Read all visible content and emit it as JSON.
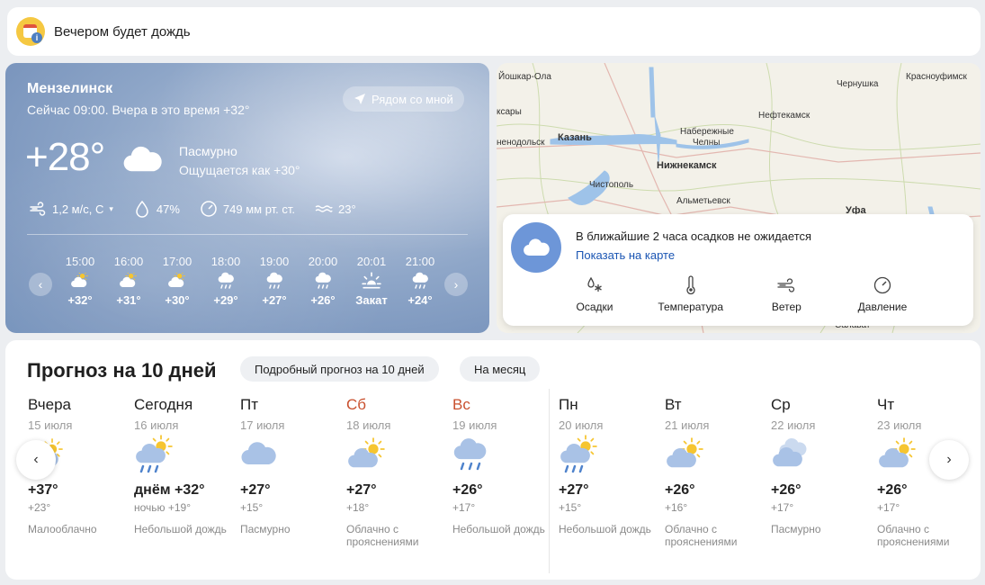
{
  "alert": {
    "text": "Вечером будет дождь",
    "icon": "calendar-info-icon"
  },
  "current": {
    "city": "Мензелинск",
    "subtitle": "Сейчас 09:00. Вчера в это время +32°",
    "nearby_label": "Рядом со мной",
    "temperature": "+28°",
    "condition": "Пасмурно",
    "feels_like": "Ощущается как +30°",
    "stats": {
      "wind": "1,2 м/с, С",
      "humidity": "47%",
      "pressure": "749 мм рт. ст.",
      "water": "23°"
    },
    "hourly": [
      {
        "time": "15:00",
        "icon": "cloud-sun-icon",
        "temp": "+32°"
      },
      {
        "time": "16:00",
        "icon": "cloud-sun-icon",
        "temp": "+31°"
      },
      {
        "time": "17:00",
        "icon": "cloud-sun-icon",
        "temp": "+30°"
      },
      {
        "time": "18:00",
        "icon": "cloud-rain-icon",
        "temp": "+29°"
      },
      {
        "time": "19:00",
        "icon": "cloud-rain-icon",
        "temp": "+27°"
      },
      {
        "time": "20:00",
        "icon": "cloud-rain-icon",
        "temp": "+26°"
      },
      {
        "time": "20:01",
        "icon": "sunset-icon",
        "temp": "Закат"
      },
      {
        "time": "21:00",
        "icon": "cloud-rain-icon",
        "temp": "+24°"
      }
    ]
  },
  "map": {
    "labels": [
      "Йошкар-Ола",
      "Чернушка",
      "Красноуфимск",
      "ксары",
      "Нефтекамск",
      "Набережные",
      "Челны",
      "Казань",
      "ненодольск",
      "Нижнекамск",
      "Чистополь",
      "Альметьевск",
      "Уфа",
      "Салават"
    ],
    "precip_title": "В ближайшие 2 часа осадков не ожидается",
    "precip_link": "Показать на карте",
    "tabs": [
      "Осадки",
      "Температура",
      "Ветер",
      "Давление"
    ]
  },
  "forecast": {
    "title": "Прогноз на 10 дней",
    "detailed_btn": "Подробный прогноз на 10 дней",
    "month_btn": "На месяц",
    "days": [
      {
        "name": "Вчера",
        "date": "15 июля",
        "icon": "partly-cloudy-icon",
        "high": "+37°",
        "low": "+23°",
        "cond": "Малооблачно",
        "weekend": false
      },
      {
        "name": "Сегодня",
        "date": "16 июля",
        "icon": "sun-cloud-rain-icon",
        "high": "днём +32°",
        "low": "ночью +19°",
        "cond": "Небольшой дождь",
        "weekend": false
      },
      {
        "name": "Пт",
        "date": "17 июля",
        "icon": "cloudy-icon",
        "high": "+27°",
        "low": "+15°",
        "cond": "Пасмурно",
        "weekend": false
      },
      {
        "name": "Сб",
        "date": "18 июля",
        "icon": "partly-cloudy-icon",
        "high": "+27°",
        "low": "+18°",
        "cond": "Облачно с прояснениями",
        "weekend": true
      },
      {
        "name": "Вс",
        "date": "19 июля",
        "icon": "cloud-rain-icon",
        "high": "+26°",
        "low": "+17°",
        "cond": "Небольшой дождь",
        "weekend": true
      },
      {
        "name": "Пн",
        "date": "20 июля",
        "icon": "sun-cloud-rain-icon",
        "high": "+27°",
        "low": "+15°",
        "cond": "Небольшой дождь",
        "weekend": false
      },
      {
        "name": "Вт",
        "date": "21 июля",
        "icon": "partly-cloudy-icon",
        "high": "+26°",
        "low": "+16°",
        "cond": "Облачно с прояснениями",
        "weekend": false
      },
      {
        "name": "Ср",
        "date": "22 июля",
        "icon": "cloudy-icon",
        "high": "+26°",
        "low": "+17°",
        "cond": "Пасмурно",
        "weekend": false
      },
      {
        "name": "Чт",
        "date": "23 июля",
        "icon": "partly-cloudy-icon",
        "high": "+26°",
        "low": "+17°",
        "cond": "Облачно с прояснениями",
        "weekend": false
      }
    ]
  },
  "colors": {
    "accent_link": "#1a55b3",
    "weekend": "#c9502e",
    "sun": "#f6c530",
    "cloud": "#a9c2e6",
    "rain": "#4f83cc"
  }
}
